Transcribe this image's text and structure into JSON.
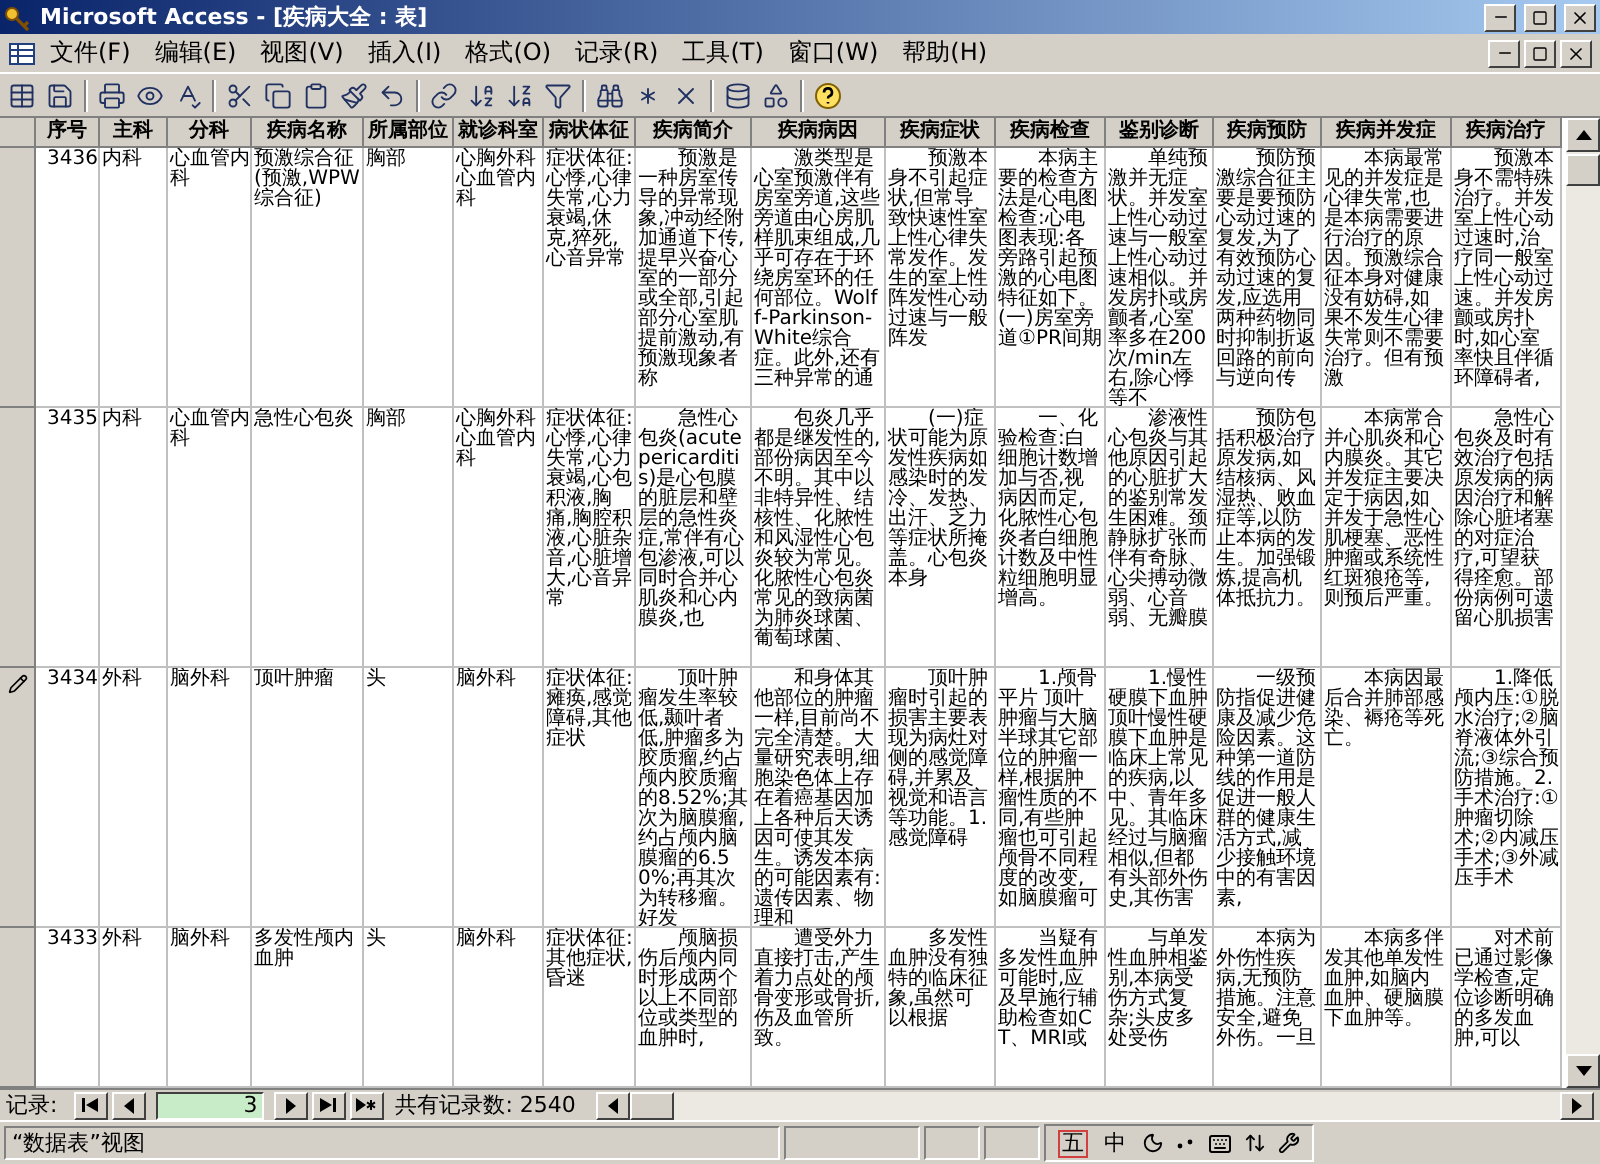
{
  "window": {
    "title": "Microsoft Access - [疾病大全 : 表]"
  },
  "menu": [
    "文件(F)",
    "编辑(E)",
    "视图(V)",
    "插入(I)",
    "格式(O)",
    "记录(R)",
    "工具(T)",
    "窗口(W)",
    "帮助(H)"
  ],
  "table": {
    "columns": [
      "序号",
      "主科",
      "分科",
      "疾病名称",
      "所属部位",
      "就诊科室",
      "病状体征",
      "疾病简介",
      "疾病病因",
      "疾病症状",
      "疾病检查",
      "鉴别诊断",
      "疾病预防",
      "疾病并发症",
      "疾病治疗"
    ],
    "rows": [
      {
        "editing": false,
        "cells": [
          "3436",
          "内科",
          "心血管内科",
          "预激综合征(预激,WPW综合征)",
          "胸部",
          "心胸外科心血管内科",
          "症状体征:心悸,心律失常,心力衰竭,休克,猝死,心音异常",
          "预激是一种房室传导的异常现象,冲动经附加通道下传,提早兴奋心室的一部分或全部,引起部分心室肌提前激动,有预激现象者称",
          "激类型是心室预激伴有房室旁道,这些旁道由心房肌样肌束组成,几乎可存在于环绕房室环的任何部位。Wolff-Parkinson-White综合症。此外,还有三种异常的通",
          "预激本身不引起症状,但常导致快速性室上性心律失常发作。发生的室上性阵发性心动过速与一般阵发",
          "本病主要的检查方法是心电图检查:心电图表现:各旁路引起预激的心电图特征如下。(一)房室旁道①PR间期",
          "单纯预激并无症状。并发室上性心动过速与一般室上性心动过速相似。并发房扑或房颤者,心室率多在200次/min左右,除心悸等不",
          "预防预激综合征主要是要预防心动过速的复发,为了有效预防心动过速的复发,应选用两种药物同时抑制折返回路的前向与逆向传",
          "本病最常见的并发症是心律失常,也是本病需要进行治疗的原因。预激综合征本身对健康没有妨碍,如果不发生心律失常则不需要治疗。但有预激",
          "预激本身不需特殊治疗。并发室上性心动过速时,治疗同一般室上性心动过速。并发房颤或房扑时,如心室率快且伴循环障碍者,"
        ]
      },
      {
        "editing": false,
        "cells": [
          "3435",
          "内科",
          "心血管内科",
          "急性心包炎",
          "胸部",
          "心胸外科心血管内科",
          "症状体征:心悸,心律失常,心力衰竭,心包积液,胸痛,胸腔积液,心脏杂音,心脏增大,心音异常",
          "急性心包炎(acute pericarditis)是心包膜的脏层和壁层的急性炎症,常伴有心包渗液,可以同时合并心肌炎和心内膜炎,也",
          "包炎几乎都是继发性的,部份病因至今不明。其中以非特异性、结核性、化脓性和风湿性心包炎较为常见。化脓性心包炎常见的致病菌为肺炎球菌、葡萄球菌、",
          "(一)症状可能为原发性疾病如感染时的发冷、发热、出汗、乏力等症状所掩盖。心包炎本身",
          "一、化验检查:白细胞计数增加与否,视病因而定,化脓性心包炎者白细胞计数及中性粒细胞明显增高。",
          "渗液性心包炎与其他原因引起的心脏扩大的鉴别常发生困难。颈静脉扩张而伴有奇脉、心尖搏动微弱、心音弱、无瓣膜",
          "预防包括积极治疗原发病,如结核病、风湿热、败血症等,以防止本病的发生。加强锻炼,提高机体抵抗力。",
          "本病常合并心肌炎和心内膜炎。其它并发症主要决定于病因,如并发于急性心肌梗塞、恶性肿瘤或系统性红斑狼疮等,则预后严重。",
          "急性心包炎及时有效治疗包括原发病的病因治疗和解除心脏堵塞的对症治疗,可望获得痊愈。部份病例可遗留心肌损害"
        ]
      },
      {
        "editing": true,
        "cells": [
          "3434",
          "外科",
          "脑外科",
          "顶叶肿瘤",
          "头",
          "脑外科",
          "症状体征:瘫痪,感觉障碍,其他症状",
          "顶叶肿瘤发生率较低,颞叶者低,肿瘤多为胶质瘤,约占颅内胶质瘤的8.52%;其次为脑膜瘤,约占颅内脑膜瘤的6.50%;再其次为转移瘤。好发",
          "和身体其他部位的肿瘤一样,目前尚不完全清楚。大量研究表明,细胞染色体上存在着癌基因加上各种后天诱因可使其发生。诱发本病的可能因素有:遗传因素、物理和",
          "顶叶肿瘤时引起的损害主要表现为病灶对侧的感觉障碍,并累及视觉和语言等功能。1.感觉障碍",
          "1.颅骨平片 顶叶肿瘤与大脑半球其它部位的肿瘤一样,根据肿瘤性质的不同,有些肿瘤也可引起颅骨不同程度的改变,如脑膜瘤可",
          "1.慢性硬膜下血肿顶叶慢性硬膜下血肿是临床上常见的疾病,以中、青年多见。其临床经过与脑瘤相似,但都有头部外伤史,其伤害",
          "一级预防指促进健康及减少危险因素。这种第一道防线的作用是促进一般人群的健康生活方式,减少接触环境中的有害因素,",
          "本病因最后合并肺部感染、褥疮等死亡。",
          "1.降低颅内压:①脱水治疗;②脑脊液体外引流;③综合预防措施。2.手术治疗:①肿瘤切除术;②内减压手术;③外减压手术"
        ]
      },
      {
        "editing": false,
        "cells": [
          "3433",
          "外科",
          "脑外科",
          "多发性颅内血肿",
          "头",
          "脑外科",
          "症状体征:其他症状,昏迷",
          "颅脑损伤后颅内同时形成两个以上不同部位或类型的血肿时,",
          "遭受外力直接打击,产生着力点处的颅骨变形或骨折,伤及血管所致。",
          "多发性血肿没有独特的临床征象,虽然可以根据",
          "当疑有多发性血肿可能时,应及早施行辅助检查如CT、MRI或",
          "与单发性血肿相鉴别,本病受伤方式复杂;头皮多处受伤",
          "本病为外伤性疾病,无预防措施。注意安全,避免外伤。一旦",
          "本病多伴发其他单发性血肿,如脑内血肿、硬脑膜下血肿等。",
          "对术前已通过影像学检查,定位诊断明确的多发血肿,可以"
        ]
      }
    ]
  },
  "navigation": {
    "label": "记录:",
    "current": "3",
    "total": "共有记录数: 2540"
  },
  "status_bar": {
    "text": "“数据表”视图",
    "ime": [
      "五",
      "中"
    ]
  }
}
